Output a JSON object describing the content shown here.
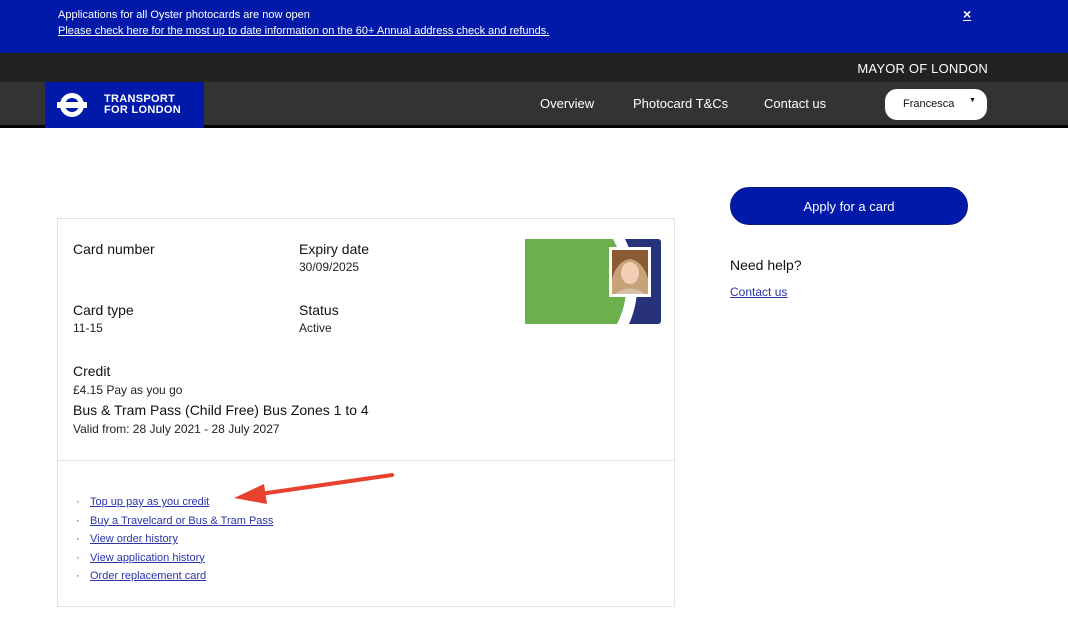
{
  "banner": {
    "message": "Applications for all Oyster photocards are now open",
    "link_text": "Please check here for the most up to date information on the 60+ Annual address check and refunds.",
    "close_label": "×"
  },
  "mayor_bar": {
    "text": "MAYOR OF LONDON"
  },
  "header": {
    "logo_line1": "TRANSPORT",
    "logo_line2": "FOR LONDON",
    "nav": [
      "Overview",
      "Photocard T&Cs",
      "Contact us"
    ],
    "user_name": "Francesca",
    "user_caret": "▼"
  },
  "card": {
    "card_number_label": "Card number",
    "card_number_value": "",
    "expiry_label": "Expiry date",
    "expiry_value": "30/09/2025",
    "type_label": "Card type",
    "type_value": "11-15",
    "status_label": "Status",
    "status_value": "Active",
    "credit_label": "Credit",
    "credit_value": "£4.15 Pay as you go",
    "pass_title": "Bus & Tram Pass (Child Free) Bus Zones 1 to 4",
    "pass_validity": "Valid from: 28 July 2021 - 28 July 2027"
  },
  "actions": [
    "Top up pay as you credit",
    "Buy a Travelcard or Bus & Tram Pass",
    "View order history",
    "View application history",
    "Order replacement card"
  ],
  "bullet": "·",
  "sidebar": {
    "apply_label": "Apply for a card",
    "help_title": "Need help?",
    "contact_label": "Contact us"
  },
  "colors": {
    "tfl_blue": "#0019a8",
    "card_green": "#6ab04c",
    "card_navy": "#27327a",
    "arrow_red": "#e8412d"
  }
}
